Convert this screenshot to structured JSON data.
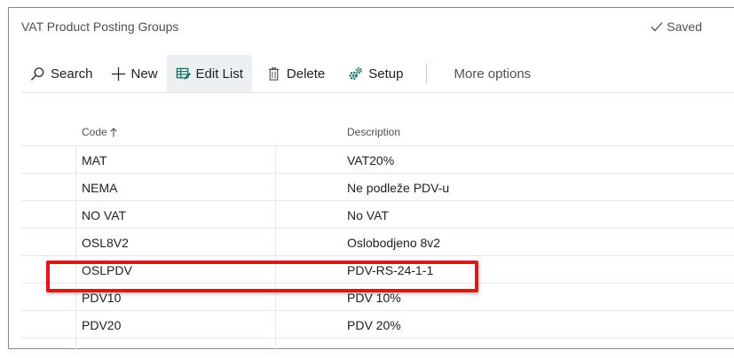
{
  "page": {
    "title": "VAT Product Posting Groups",
    "saved_label": "Saved"
  },
  "toolbar": {
    "search_label": "Search",
    "new_label": "New",
    "edit_list_label": "Edit List",
    "delete_label": "Delete",
    "setup_label": "Setup",
    "more_options_label": "More options"
  },
  "table": {
    "columns": [
      {
        "label": "Code",
        "sort": "ascending"
      },
      {
        "label": "Description"
      }
    ],
    "rows": [
      {
        "code": "MAT",
        "description": "VAT20%"
      },
      {
        "code": "NEMA",
        "description": "Ne podleže PDV-u"
      },
      {
        "code": "NO VAT",
        "description": "No VAT"
      },
      {
        "code": "OSL8V2",
        "description": "Oslobodjeno 8v2"
      },
      {
        "code": "OSLPDV",
        "description": "PDV-RS-24-1-1",
        "highlighted": true
      },
      {
        "code": "PDV10",
        "description": "PDV 10%"
      },
      {
        "code": "PDV20",
        "description": "PDV 20%"
      }
    ]
  },
  "colors": {
    "highlight": "#e3141b",
    "active_button_bg": "#edf0f2"
  },
  "icons": {
    "search": "search-icon",
    "new": "plus-icon",
    "edit_list": "edit-list-icon",
    "delete": "trash-icon",
    "setup": "gears-icon",
    "saved": "checkmark-icon",
    "sort": "arrow-up-icon"
  }
}
